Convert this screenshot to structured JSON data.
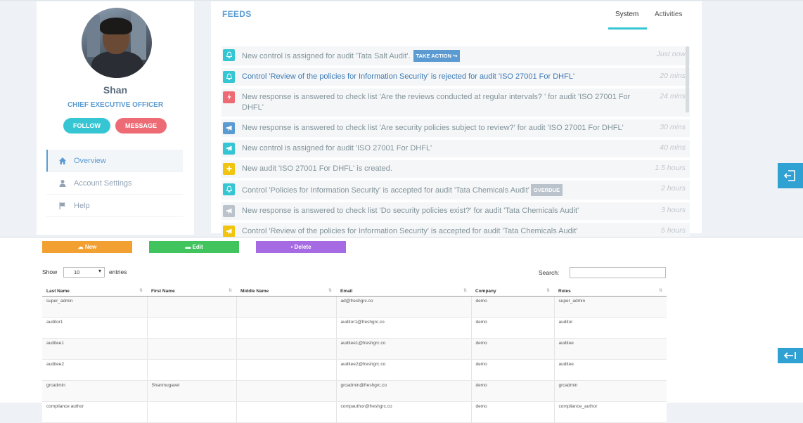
{
  "profile": {
    "name": "Shan",
    "role": "CHIEF EXECUTIVE OFFICER",
    "follow_label": "FOLLOW",
    "message_label": "MESSAGE",
    "nav": [
      {
        "label": "Overview",
        "icon": "home-icon"
      },
      {
        "label": "Account Settings",
        "icon": "user-icon"
      },
      {
        "label": "Help",
        "icon": "flag-icon"
      }
    ]
  },
  "feeds": {
    "title": "FEEDS",
    "tabs": [
      "System",
      "Activities"
    ],
    "active_tab": "System",
    "take_action_label": "TAKE ACTION",
    "overdue_label": "OVERDUE",
    "items": [
      {
        "text": "New control is assigned for audit 'Tata Salt Audit'.",
        "time": "Just now",
        "icon": "bell-icon",
        "color": "#36c6d3"
      },
      {
        "text": "Control 'Review of the policies for Information Security' is rejected for audit 'ISO 27001 For DHFL'",
        "time": "20 mins",
        "icon": "bell-icon",
        "color": "#36c6d3"
      },
      {
        "text": "New response is answered to check list 'Are the reviews conducted at regular intervals? ' for audit 'ISO 27001 For DHFL'",
        "time": "24 mins",
        "icon": "bolt-icon",
        "color": "#ed6b75"
      },
      {
        "text": "New response is answered to check list 'Are security policies subject to review?' for audit 'ISO 27001 For DHFL'",
        "time": "30 mins",
        "icon": "bullhorn-icon",
        "color": "#5c9bd1"
      },
      {
        "text": "New control is assigned for audit 'ISO 27001 For DHFL'",
        "time": "40 mins",
        "icon": "bullhorn-icon",
        "color": "#36c6d3"
      },
      {
        "text": "New audit 'ISO 27001 For DHFL' is created.",
        "time": "1.5 hours",
        "icon": "plus-icon",
        "color": "#f1c40f"
      },
      {
        "text": "Control 'Policies for Information Security' is accepted for audit 'Tata Chemicals Audit'",
        "time": "2 hours",
        "icon": "bell-icon",
        "color": "#36c6d3"
      },
      {
        "text": "New response is answered to check list 'Do security policies exist?' for audit 'Tata Chemicals Audit'",
        "time": "3 hours",
        "icon": "bullhorn-icon",
        "color": "#bac3cc"
      },
      {
        "text": "Control 'Review of the policies for Information Security' is accepted for audit 'Tata Chemicals Audit'",
        "time": "5 hours",
        "icon": "bullhorn-icon",
        "color": "#f1c40f"
      }
    ]
  },
  "toolbar": {
    "new_label": "New",
    "edit_label": "Edit",
    "delete_label": "Delete"
  },
  "table_controls": {
    "show_label": "Show",
    "page_size": "10",
    "entries_label": "entries",
    "search_label": "Search:"
  },
  "table": {
    "columns": [
      "Last Name",
      "First Name",
      "Middle Name",
      "Email",
      "Company",
      "Roles"
    ],
    "rows": [
      [
        "super_admin",
        "",
        "",
        "ad@freshgrc.co",
        "demo",
        "super_admin"
      ],
      [
        "auditor1",
        "",
        "",
        "auditor1@freshgrc.co",
        "demo",
        "auditor"
      ],
      [
        "auditee1",
        "",
        "",
        "auditee1@freshgrc.co",
        "demo",
        "auditee"
      ],
      [
        "auditee2",
        "",
        "",
        "auditee2@freshgrc.co",
        "demo",
        "auditee"
      ],
      [
        "grcadmin",
        "Shanmugavel",
        "",
        "grcadmin@freshgrc.co",
        "demo",
        "grcadmin"
      ],
      [
        "compliance author",
        "",
        "",
        "compauthor@freshgrc.co",
        "demo",
        "compliance_author"
      ]
    ]
  }
}
